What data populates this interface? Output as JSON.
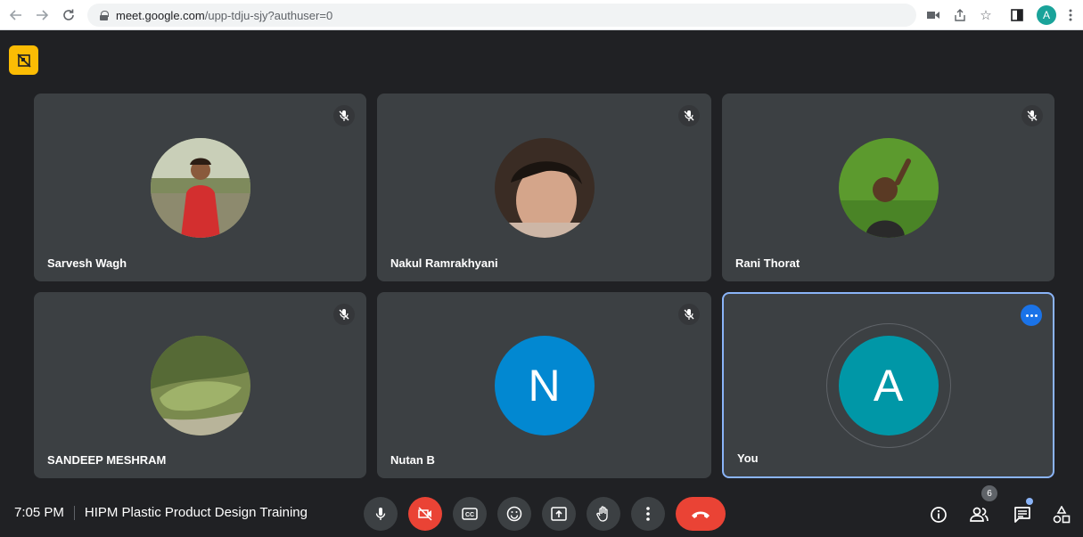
{
  "browser": {
    "url_host": "meet.google.com",
    "url_path": "/upp-tdju-sjy?authuser=0",
    "profile_letter": "A"
  },
  "participants": [
    {
      "name": "Sarvesh Wagh",
      "avatar": "photo",
      "muted": true
    },
    {
      "name": "Nakul Ramrakhyani",
      "avatar": "photo",
      "muted": true
    },
    {
      "name": "Rani Thorat",
      "avatar": "photo",
      "muted": true
    },
    {
      "name": "SANDEEP MESHRAM",
      "avatar": "photo",
      "muted": true
    },
    {
      "name": "Nutan B",
      "avatar_letter": "N",
      "avatar_color": "#0288d1",
      "muted": true
    },
    {
      "name": "You",
      "avatar_letter": "A",
      "avatar_color": "#0097a7",
      "muted": false
    }
  ],
  "meeting": {
    "time": "7:05 PM",
    "title": "HIPM Plastic Product Design Training"
  },
  "controls": [
    "mic-icon",
    "camera-off-icon",
    "captions-icon",
    "emoji-icon",
    "present-icon",
    "raise-hand-icon",
    "more-options-icon",
    "hang-up-icon"
  ],
  "side_controls": {
    "people_count": "6",
    "icons": [
      "info-icon",
      "people-icon",
      "chat-icon",
      "activities-icon"
    ]
  },
  "colors": {
    "background": "#202124",
    "tile": "#3c4043",
    "danger": "#ea4335",
    "highlight": "#8ab4f8",
    "tiles_off": "#fbbc04"
  }
}
